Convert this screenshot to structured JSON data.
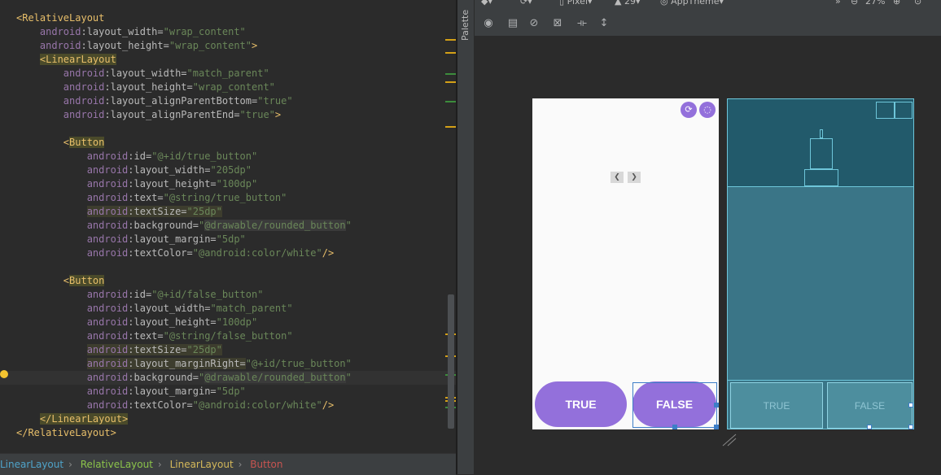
{
  "editor": {
    "lines": [
      [
        {
          "t": "<",
          "c": "tag"
        },
        {
          "t": "RelativeLayout",
          "c": "tag"
        }
      ],
      [
        {
          "t": "    "
        },
        {
          "t": "android",
          "c": "ns"
        },
        {
          "t": ":layout_width=",
          "c": "attr"
        },
        {
          "t": "\"wrap_content\"",
          "c": "val"
        }
      ],
      [
        {
          "t": "    "
        },
        {
          "t": "android",
          "c": "ns"
        },
        {
          "t": ":layout_height=",
          "c": "attr"
        },
        {
          "t": "\"wrap_content\"",
          "c": "val"
        },
        {
          "t": ">",
          "c": "tag"
        }
      ],
      [
        {
          "t": "    "
        },
        {
          "t": "<LinearLayout",
          "c": "tag hl"
        }
      ],
      [
        {
          "t": "        "
        },
        {
          "t": "android",
          "c": "ns"
        },
        {
          "t": ":layout_width=",
          "c": "attr"
        },
        {
          "t": "\"match_parent\"",
          "c": "val"
        }
      ],
      [
        {
          "t": "        "
        },
        {
          "t": "android",
          "c": "ns"
        },
        {
          "t": ":layout_height=",
          "c": "attr"
        },
        {
          "t": "\"wrap_content\"",
          "c": "val"
        }
      ],
      [
        {
          "t": "        "
        },
        {
          "t": "android",
          "c": "ns"
        },
        {
          "t": ":layout_alignParentBottom=",
          "c": "attr"
        },
        {
          "t": "\"true\"",
          "c": "val"
        }
      ],
      [
        {
          "t": "        "
        },
        {
          "t": "android",
          "c": "ns"
        },
        {
          "t": ":layout_alignParentEnd=",
          "c": "attr"
        },
        {
          "t": "\"true\"",
          "c": "val"
        },
        {
          "t": ">",
          "c": "tag"
        }
      ],
      [
        {
          "t": ""
        }
      ],
      [
        {
          "t": "        "
        },
        {
          "t": "<",
          "c": "tag"
        },
        {
          "t": "Button",
          "c": "tag hl"
        }
      ],
      [
        {
          "t": "            "
        },
        {
          "t": "android",
          "c": "ns"
        },
        {
          "t": ":id=",
          "c": "attr"
        },
        {
          "t": "\"@+id/true_button\"",
          "c": "val"
        }
      ],
      [
        {
          "t": "            "
        },
        {
          "t": "android",
          "c": "ns"
        },
        {
          "t": ":layout_width=",
          "c": "attr"
        },
        {
          "t": "\"205dp\"",
          "c": "val"
        }
      ],
      [
        {
          "t": "            "
        },
        {
          "t": "android",
          "c": "ns"
        },
        {
          "t": ":layout_height=",
          "c": "attr"
        },
        {
          "t": "\"100dp\"",
          "c": "val"
        }
      ],
      [
        {
          "t": "            "
        },
        {
          "t": "android",
          "c": "ns"
        },
        {
          "t": ":text=",
          "c": "attr"
        },
        {
          "t": "\"@string/true_button\"",
          "c": "val"
        }
      ],
      [
        {
          "t": "            "
        },
        {
          "t": "android",
          "c": "ns attrhl"
        },
        {
          "t": ":textSize=",
          "c": "attr attrhl"
        },
        {
          "t": "\"25dp\"",
          "c": "val attrhl"
        }
      ],
      [
        {
          "t": "            "
        },
        {
          "t": "android",
          "c": "ns"
        },
        {
          "t": ":background=",
          "c": "attr"
        },
        {
          "t": "\"",
          "c": "val"
        },
        {
          "t": "@drawable/rounded_button",
          "c": "val ref"
        },
        {
          "t": "\"",
          "c": "val"
        }
      ],
      [
        {
          "t": "            "
        },
        {
          "t": "android",
          "c": "ns"
        },
        {
          "t": ":layout_margin=",
          "c": "attr"
        },
        {
          "t": "\"5dp\"",
          "c": "val"
        }
      ],
      [
        {
          "t": "            "
        },
        {
          "t": "android",
          "c": "ns"
        },
        {
          "t": ":textColor=",
          "c": "attr"
        },
        {
          "t": "\"@android:color/white\"",
          "c": "val"
        },
        {
          "t": "/>",
          "c": "tag"
        }
      ],
      [
        {
          "t": ""
        }
      ],
      [
        {
          "t": "        "
        },
        {
          "t": "<",
          "c": "tag"
        },
        {
          "t": "Button",
          "c": "tag hl"
        }
      ],
      [
        {
          "t": "            "
        },
        {
          "t": "android",
          "c": "ns"
        },
        {
          "t": ":id=",
          "c": "attr"
        },
        {
          "t": "\"@+id/false_button\"",
          "c": "val"
        }
      ],
      [
        {
          "t": "            "
        },
        {
          "t": "android",
          "c": "ns"
        },
        {
          "t": ":layout_width=",
          "c": "attr"
        },
        {
          "t": "\"match_parent\"",
          "c": "val"
        }
      ],
      [
        {
          "t": "            "
        },
        {
          "t": "android",
          "c": "ns"
        },
        {
          "t": ":layout_height=",
          "c": "attr"
        },
        {
          "t": "\"100dp\"",
          "c": "val"
        }
      ],
      [
        {
          "t": "            "
        },
        {
          "t": "android",
          "c": "ns"
        },
        {
          "t": ":text=",
          "c": "attr"
        },
        {
          "t": "\"@string/false_button\"",
          "c": "val"
        }
      ],
      [
        {
          "t": "            "
        },
        {
          "t": "android",
          "c": "ns attrhl"
        },
        {
          "t": ":textSize=",
          "c": "attr attrhl"
        },
        {
          "t": "\"25dp\"",
          "c": "val attrhl"
        }
      ],
      [
        {
          "t": "            "
        },
        {
          "t": "android",
          "c": "ns attrhl"
        },
        {
          "t": ":layout_marginRight=",
          "c": "attr attrhl"
        },
        {
          "t": "\"@+id/true_button\"",
          "c": "val"
        }
      ],
      [
        {
          "t": "            "
        },
        {
          "t": "android",
          "c": "ns"
        },
        {
          "t": ":background=",
          "c": "attr"
        },
        {
          "t": "\"",
          "c": "val"
        },
        {
          "t": "@drawable/rounded_button",
          "c": "val ref"
        },
        {
          "t": "\"",
          "c": "val"
        }
      ],
      [
        {
          "t": "            "
        },
        {
          "t": "android",
          "c": "ns"
        },
        {
          "t": ":layout_margin=",
          "c": "attr"
        },
        {
          "t": "\"5dp\"",
          "c": "val"
        }
      ],
      [
        {
          "t": "            "
        },
        {
          "t": "android",
          "c": "ns"
        },
        {
          "t": ":textColor=",
          "c": "attr"
        },
        {
          "t": "\"@android:color/white\"",
          "c": "val"
        },
        {
          "t": "/>",
          "c": "tag"
        }
      ],
      [
        {
          "t": "    "
        },
        {
          "t": "</LinearLayout>",
          "c": "tag hl"
        }
      ],
      [
        {
          "t": "</RelativeLayout>",
          "c": "tag"
        }
      ]
    ],
    "caret_line": 26
  },
  "breadcrumb": [
    {
      "label": "LinearLayout",
      "color": "#4fa3c9"
    },
    {
      "label": "RelativeLayout",
      "color": "#8bc34a"
    },
    {
      "label": "LinearLayout",
      "color": "#d4b85a"
    },
    {
      "label": "Button",
      "color": "#c75450"
    }
  ],
  "palette": {
    "label": "Palette"
  },
  "toolbar": {
    "device": "Pixel",
    "api": "29",
    "theme": "AppTheme",
    "zoom": "27%"
  },
  "preview": {
    "true_label": "TRUE",
    "false_label": "FALSE"
  },
  "blueprint": {
    "true_label": "TRUE",
    "false_label": "FALSE"
  },
  "colors": {
    "button_purple": "#9370db",
    "selection_blue": "#3d7ec7",
    "blueprint_bg": "#3a7587"
  }
}
